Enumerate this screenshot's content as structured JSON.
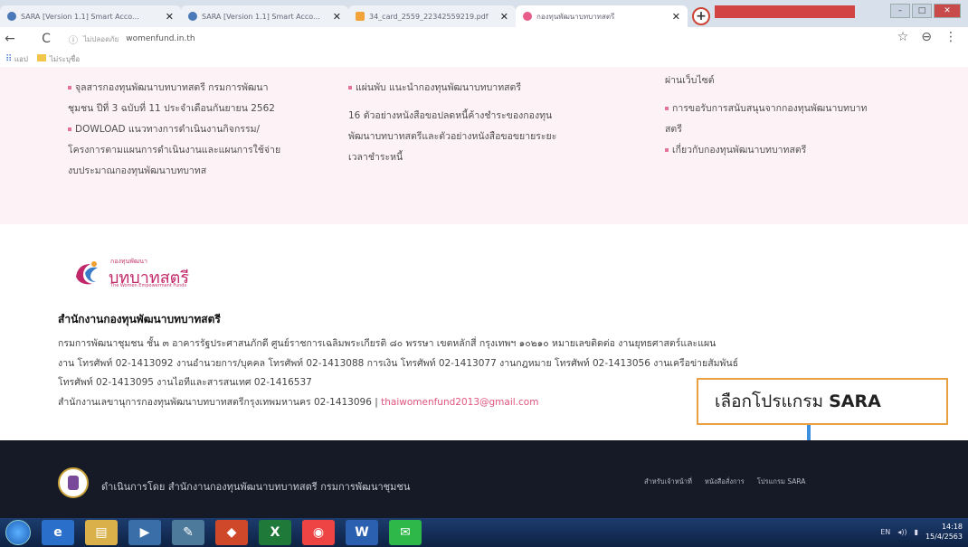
{
  "browser": {
    "tabs": [
      {
        "title": "SARA [Version 1.1] Smart Acco...",
        "close": "✕"
      },
      {
        "title": "SARA [Version 1.1] Smart Acco...",
        "close": "✕"
      },
      {
        "title": "34_card_2559_22342559219.pdf",
        "close": "✕"
      },
      {
        "title": "กองทุนพัฒนาบทบาทสตรี",
        "close": "✕"
      }
    ],
    "new_tab": "+",
    "window_buttons": [
      "–",
      "□",
      "✕"
    ],
    "address": {
      "back": "←",
      "reload": "C",
      "info": "ⓘ",
      "secure_label": "ไม่ปลอดภัย",
      "url": "womenfund.in.th",
      "star": "☆",
      "account": "⊖",
      "menu": "⋮"
    },
    "bookmarks": {
      "apps_label": "แอป",
      "folder_label": "ไม่ระบุชื่อ"
    }
  },
  "links": {
    "col1": [
      "จุลสารกองทุนพัฒนาบทบาทสตรี กรมการพัฒนา",
      "ชุมชน ปีที่ 3 ฉบับที่ 11 ประจำเดือนกันยายน 2562",
      "DOWLOAD แนวทางการดำเนินงานกิจกรรม/",
      "โครงการตามแผนการดำเนินงานและแผนการใช้จ่าย",
      "งบประมาณกองทุนพัฒนาบทบาทส"
    ],
    "col2": [
      "แผ่นพับ แนะนำกองทุนพัฒนาบทบาทสตรี",
      "16 ตัวอย่างหนังสือขอปลดหนี้ค้างชำระของกองทุน",
      "พัฒนาบทบาทสตรีและตัวอย่างหนังสือขอขยายระยะ",
      "เวลาชำระหนี้"
    ],
    "col3": [
      "ผ่านเว็บไซต์",
      "การขอรับการสนับสนุนจากกองทุนพัฒนาบทบาท",
      "สตรี",
      "เกี่ยวกับกองทุนพัฒนาบทบาทสตรี"
    ]
  },
  "logo": {
    "small": "กองทุนพัฒนา",
    "name": "บทบาทสตรี",
    "english": "The Women Empowerment Funds"
  },
  "org": {
    "title": "สำนักงานกองทุนพัฒนาบทบาทสตรี",
    "line1": "กรมการพัฒนาชุมชน ชั้น ๓ อาคารรัฐประศาสนภักดี ศูนย์ราชการเฉลิมพระเกียรติ ๘๐ พรรษา เขตหลักสี่ กรุงเทพฯ ๑๐๒๑๐ หมายเลขติดต่อ งานยุทธศาสตร์และแผน",
    "line2": "งาน โทรศัพท์ 02-1413092 งานอำนวยการ/บุคคล โทรศัพท์ 02-1413088 การเงิน โทรศัพท์ 02-1413077 งานกฎหมาย โทรศัพท์ 02-1413056 งานเครือข่ายสัมพันธ์",
    "line3": "โทรศัพท์ 02-1413095 งานไอทีและสารสนเทศ 02-1416537",
    "line4": "สำนักงานเลขานุการกองทุนพัฒนาบทบาทสตรีกรุงเทพมหานคร 02-1413096 |",
    "email": "thaiwomenfund2013@gmail.com"
  },
  "callout": {
    "prefix": "เลือกโปรแกรม",
    "bold": "SARA"
  },
  "footer": {
    "text": "ดำเนินการโดย สำนักงานกองทุนพัฒนาบทบาทสตรี กรมการพัฒนาชุมชน",
    "links": [
      "สำหรับเจ้าหน้าที่",
      "หนังสือสั่งการ",
      "โปรแกรม SARA"
    ]
  },
  "taskbar": {
    "apps": [
      "e",
      "▤",
      "▶",
      "✎",
      "◆",
      "X",
      "◉",
      "W",
      "✉"
    ],
    "lang": "EN",
    "time": "14:18",
    "date": "15/4/2563"
  },
  "colors": {
    "pink_bg": "#fdf2f5",
    "brand_pink": "#c1286a",
    "callout_border": "#e8a040",
    "arrow_blue": "#3d8fe0",
    "footer_dark": "#151a26"
  }
}
